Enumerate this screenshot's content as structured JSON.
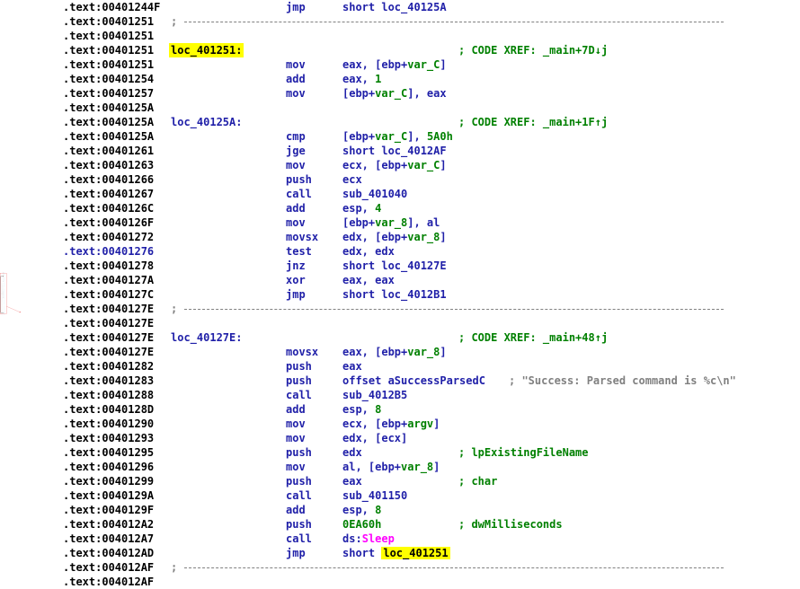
{
  "lines": [
    {
      "addr": "00401244F",
      "mn": "jmp",
      "op": [
        {
          "t": "short loc_40125A"
        }
      ]
    },
    {
      "addr": "00401251",
      "sep": true
    },
    {
      "addr": "00401251"
    },
    {
      "addr": "00401251",
      "label": "loc_401251:",
      "label_hl": true,
      "comment": "; CODE XREF: _main+7D↓j"
    },
    {
      "addr": "00401251",
      "mn": "mov",
      "op": [
        {
          "t": "eax, [ebp+"
        },
        {
          "t": "var_C",
          "c": "var"
        },
        {
          "t": "]"
        }
      ]
    },
    {
      "addr": "00401254",
      "mn": "add",
      "op": [
        {
          "t": "eax, "
        },
        {
          "t": "1",
          "c": "num"
        }
      ]
    },
    {
      "addr": "00401257",
      "mn": "mov",
      "op": [
        {
          "t": "[ebp+"
        },
        {
          "t": "var_C",
          "c": "var"
        },
        {
          "t": "], eax"
        }
      ]
    },
    {
      "addr": "0040125A"
    },
    {
      "addr": "0040125A",
      "label": "loc_40125A:",
      "comment": "; CODE XREF: _main+1F↑j"
    },
    {
      "addr": "0040125A",
      "mn": "cmp",
      "op": [
        {
          "t": "[ebp+"
        },
        {
          "t": "var_C",
          "c": "var"
        },
        {
          "t": "], "
        },
        {
          "t": "5A0h",
          "c": "num"
        }
      ]
    },
    {
      "addr": "00401261",
      "mn": "jge",
      "op": [
        {
          "t": "short loc_4012AF"
        }
      ]
    },
    {
      "addr": "00401263",
      "mn": "mov",
      "op": [
        {
          "t": "ecx, [ebp+"
        },
        {
          "t": "var_C",
          "c": "var"
        },
        {
          "t": "]"
        }
      ]
    },
    {
      "addr": "00401266",
      "mn": "push",
      "op": [
        {
          "t": "ecx"
        }
      ]
    },
    {
      "addr": "00401267",
      "mn": "call",
      "op": [
        {
          "t": "sub_401040"
        }
      ]
    },
    {
      "addr": "0040126C",
      "mn": "add",
      "op": [
        {
          "t": "esp, "
        },
        {
          "t": "4",
          "c": "num"
        }
      ]
    },
    {
      "addr": "0040126F",
      "mn": "mov",
      "op": [
        {
          "t": "[ebp+"
        },
        {
          "t": "var_8",
          "c": "var"
        },
        {
          "t": "], al"
        }
      ]
    },
    {
      "addr": "00401272",
      "mn": "movsx",
      "op": [
        {
          "t": "edx, [ebp+"
        },
        {
          "t": "var_8",
          "c": "var"
        },
        {
          "t": "]"
        }
      ]
    },
    {
      "addr": "00401276",
      "blue": true,
      "mn": "test",
      "op": [
        {
          "t": "edx, edx"
        }
      ]
    },
    {
      "addr": "00401278",
      "mn": "jnz",
      "op": [
        {
          "t": "short loc_40127E"
        }
      ]
    },
    {
      "addr": "0040127A",
      "mn": "xor",
      "op": [
        {
          "t": "eax, eax"
        }
      ]
    },
    {
      "addr": "0040127C",
      "mn": "jmp",
      "op": [
        {
          "t": "short loc_4012B1"
        }
      ]
    },
    {
      "addr": "0040127E",
      "sep": true
    },
    {
      "addr": "0040127E"
    },
    {
      "addr": "0040127E",
      "label": "loc_40127E:",
      "comment": "; CODE XREF: _main+48↑j"
    },
    {
      "addr": "0040127E",
      "mn": "movsx",
      "op": [
        {
          "t": "eax, [ebp+"
        },
        {
          "t": "var_8",
          "c": "var"
        },
        {
          "t": "]"
        }
      ]
    },
    {
      "addr": "00401282",
      "mn": "push",
      "op": [
        {
          "t": "eax"
        }
      ]
    },
    {
      "addr": "00401283",
      "mn": "push",
      "op": [
        {
          "t": "offset aSuccessParsedC"
        }
      ],
      "comment": "; \"Success: Parsed command is %c\\n\"",
      "str": true
    },
    {
      "addr": "00401288",
      "mn": "call",
      "op": [
        {
          "t": "sub_4012B5"
        }
      ]
    },
    {
      "addr": "0040128D",
      "mn": "add",
      "op": [
        {
          "t": "esp, "
        },
        {
          "t": "8",
          "c": "num"
        }
      ]
    },
    {
      "addr": "00401290",
      "mn": "mov",
      "op": [
        {
          "t": "ecx, [ebp+"
        },
        {
          "t": "argv",
          "c": "var"
        },
        {
          "t": "]"
        }
      ]
    },
    {
      "addr": "00401293",
      "mn": "mov",
      "op": [
        {
          "t": "edx, [ecx]"
        }
      ]
    },
    {
      "addr": "00401295",
      "mn": "push",
      "op": [
        {
          "t": "edx"
        }
      ],
      "comment": "; lpExistingFileName"
    },
    {
      "addr": "00401296",
      "mn": "mov",
      "op": [
        {
          "t": "al, [ebp+"
        },
        {
          "t": "var_8",
          "c": "var"
        },
        {
          "t": "]"
        }
      ]
    },
    {
      "addr": "00401299",
      "mn": "push",
      "op": [
        {
          "t": "eax"
        }
      ],
      "comment": "; char"
    },
    {
      "addr": "0040129A",
      "mn": "call",
      "op": [
        {
          "t": "sub_401150"
        }
      ]
    },
    {
      "addr": "0040129F",
      "mn": "add",
      "op": [
        {
          "t": "esp, "
        },
        {
          "t": "8",
          "c": "num"
        }
      ]
    },
    {
      "addr": "004012A2",
      "mn": "push",
      "op": [
        {
          "t": "0EA60h",
          "c": "num"
        }
      ],
      "comment": "; dwMilliseconds"
    },
    {
      "addr": "004012A7",
      "mn": "call",
      "op": [
        {
          "t": "ds:"
        },
        {
          "t": "Sleep",
          "c": "api"
        }
      ]
    },
    {
      "addr": "004012AD",
      "mn": "jmp",
      "op": [
        {
          "t": "short "
        },
        {
          "t": "loc_401251",
          "c": "lhl"
        }
      ]
    },
    {
      "addr": "004012AF",
      "sep": true
    },
    {
      "addr": "004012AF"
    }
  ],
  "segment_prefix": ".text:",
  "separator_text": ";",
  "colors": {
    "annotation_red": "#e8403f",
    "flow_black": "#000000",
    "bullet_blue": "#4db8e8",
    "label_highlight": "#ffff00"
  }
}
